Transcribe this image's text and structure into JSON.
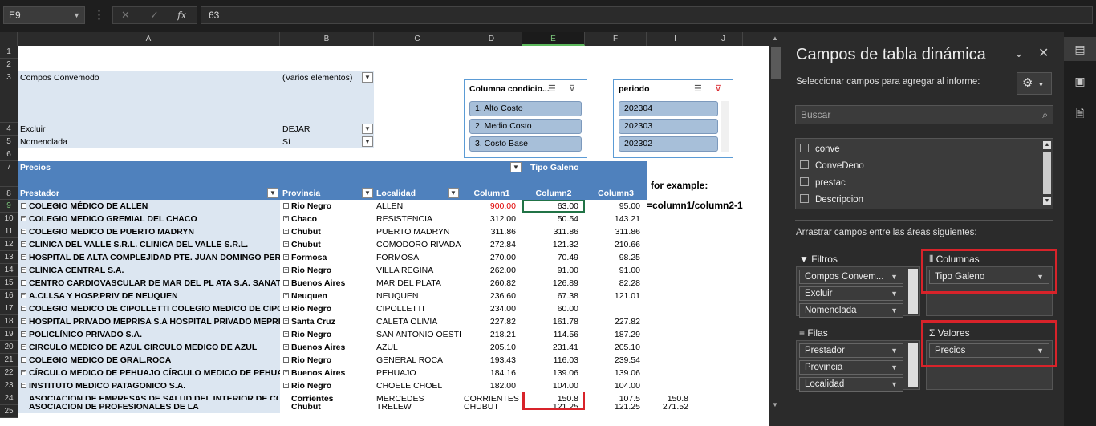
{
  "formula_bar": {
    "name_box": "E9",
    "cancel_icon": "✕",
    "enter_icon": "✓",
    "fx": "fx",
    "value": "63"
  },
  "columns": [
    "A",
    "B",
    "C",
    "D",
    "E",
    "F",
    "I",
    "J"
  ],
  "rows": [
    "1",
    "2",
    "3",
    "4",
    "5",
    "6",
    "7",
    "8",
    "9",
    "10",
    "11",
    "12",
    "13",
    "14",
    "15",
    "16",
    "17",
    "18",
    "19",
    "20",
    "21",
    "22",
    "23",
    "24",
    "25"
  ],
  "filters": {
    "r3a": "Compos Convemodo",
    "r3b": "(Varios elementos)",
    "r4a": "Excluir",
    "r4b": "DEJAR",
    "r5a": "Nomenclada",
    "r5b": "Sí"
  },
  "pivot": {
    "values_label": "Precios",
    "col_field": "Tipo Galeno",
    "h_prestador": "Prestador",
    "h_provincia": "Provincia",
    "h_localidad": "Localidad",
    "h_col1": "Column1",
    "h_col2": "Column2",
    "h_col3": "Column3",
    "rows": [
      {
        "p": "COLEGIO MÉDICO DE ALLEN",
        "v": "Rio Negro",
        "l": "ALLEN",
        "c1": "900.00",
        "c2": "63.00",
        "c3": "95.00"
      },
      {
        "p": "COLEGIO MEDICO GREMIAL DEL CHACO",
        "v": "Chaco",
        "l": "RESISTENCIA",
        "c1": "312.00",
        "c2": "50.54",
        "c3": "143.21"
      },
      {
        "p": "COLEGIO MEDICO DE PUERTO MADRYN",
        "v": "Chubut",
        "l": "PUERTO MADRYN",
        "c1": "311.86",
        "c2": "311.86",
        "c3": "311.86"
      },
      {
        "p": "CLINICA DEL VALLE S.R.L.   CLINICA DEL VALLE S.R.L.",
        "v": "Chubut",
        "l": "COMODORO RIVADAVIA",
        "c1": "272.84",
        "c2": "121.32",
        "c3": "210.66"
      },
      {
        "p": "HOSPITAL DE ALTA COMPLEJIDAD PTE. JUAN DOMINGO PERON",
        "v": "Formosa",
        "l": "FORMOSA",
        "c1": "270.00",
        "c2": "70.49",
        "c3": "98.25"
      },
      {
        "p": "CLÍNICA CENTRAL S.A.",
        "v": "Rio Negro",
        "l": "VILLA REGINA",
        "c1": "262.00",
        "c2": "91.00",
        "c3": "91.00"
      },
      {
        "p": "CENTRO CARDIOVASCULAR DE MAR DEL PL ATA S.A. SANATORIO",
        "v": "Buenos Aires",
        "l": "MAR DEL PLATA",
        "c1": "260.82",
        "c2": "126.89",
        "c3": "82.28"
      },
      {
        "p": "A.CLI.SA Y HOSP.PRIV DE NEUQUEN",
        "v": "Neuquen",
        "l": "NEUQUEN",
        "c1": "236.60",
        "c2": "67.38",
        "c3": "121.01"
      },
      {
        "p": "COLEGIO MEDICO DE CIPOLLETTI   COLEGIO MEDICO DE CIPOLLETTI",
        "v": "Rio Negro",
        "l": "CIPOLLETTI",
        "c1": "234.00",
        "c2": "60.00",
        "c3": ""
      },
      {
        "p": "HOSPITAL PRIVADO MEPRISA S.A  HOSPITAL PRIVADO MEPRISA",
        "v": "Santa Cruz",
        "l": "CALETA OLIVIA",
        "c1": "227.82",
        "c2": "161.78",
        "c3": "227.82"
      },
      {
        "p": "POLICLÍNICO PRIVADO S.A.",
        "v": "Rio Negro",
        "l": "SAN ANTONIO OESTE",
        "c1": "218.21",
        "c2": "114.56",
        "c3": "187.29"
      },
      {
        "p": "CIRCULO MEDICO DE AZUL   CIRCULO MEDICO DE AZUL",
        "v": "Buenos Aires",
        "l": "AZUL",
        "c1": "205.10",
        "c2": "231.41",
        "c3": "205.10"
      },
      {
        "p": "COLEGIO MEDICO DE GRAL.ROCA",
        "v": "Rio Negro",
        "l": "GENERAL ROCA",
        "c1": "193.43",
        "c2": "116.03",
        "c3": "239.54"
      },
      {
        "p": "CÍRCULO MEDICO DE PEHUAJO   CÍRCULO MEDICO DE PEHUAJO",
        "v": "Buenos Aires",
        "l": "PEHUAJO",
        "c1": "184.16",
        "c2": "139.06",
        "c3": "139.06"
      },
      {
        "p": "INSTITUTO MEDICO PATAGONICO S.A.",
        "v": "Rio Negro",
        "l": "CHOELE CHOEL",
        "c1": "182.00",
        "c2": "104.00",
        "c3": "104.00"
      }
    ],
    "partial_row24": {
      "p": "ASOCIACION DE EMPRESAS DE SALUD DEL INTERIOR DE CORRIENTES",
      "v": "Corrientes",
      "l": "MERCEDES",
      "c1": "CORRIENTES",
      "c2": "150.8",
      "c3": "107.5",
      "c4": "150.8"
    },
    "partial_row25": {
      "p": "ASOCIACION DE PROFESIONALES DE LA",
      "v": "Chubut",
      "l": "TRELEW",
      "c1": "CHUBUT",
      "c2": "121.25",
      "c3": "121.25",
      "c4": "271.52"
    }
  },
  "note": {
    "line1": "for example:",
    "line2": "=column1/column2-1"
  },
  "slicer1": {
    "title": "Columna condicio...",
    "items": [
      "1. Alto Costo",
      "2. Medio Costo",
      "3. Costo Base"
    ]
  },
  "slicer2": {
    "title": "periodo",
    "items": [
      "202304",
      "202303",
      "202302"
    ]
  },
  "pane": {
    "title": "Campos de tabla dinámica",
    "subtitle": "Seleccionar campos para agregar al informe:",
    "search_placeholder": "Buscar",
    "fields": [
      "conve",
      "ConveDeno",
      "prestac",
      "Descripcion"
    ],
    "drag_text": "Arrastrar campos entre las áreas siguientes:",
    "filtros_label": "Filtros",
    "filtros": [
      "Compos Convem...",
      "Excluir",
      "Nomenclada"
    ],
    "columnas_label": "Columnas",
    "columnas": [
      "Tipo Galeno"
    ],
    "filas_label": "Filas",
    "filas": [
      "Prestador",
      "Provincia",
      "Localidad"
    ],
    "valores_label": "Valores",
    "valores": [
      "Precios"
    ]
  },
  "accent_red": "#d8232a",
  "pivot_header_blue": "#4f81bd",
  "pivot_light_blue": "#dce6f1"
}
